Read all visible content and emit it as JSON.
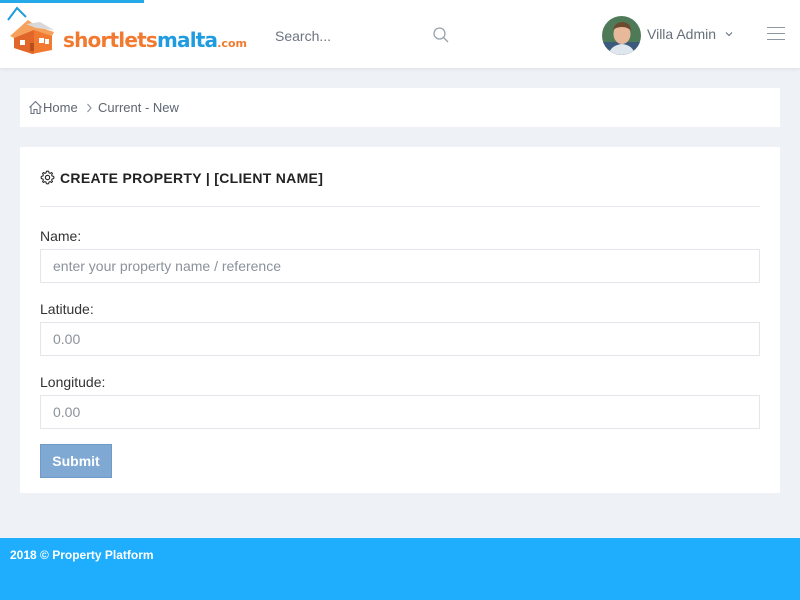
{
  "header": {
    "logo": {
      "brand": "shortlets",
      "brand_accent": "malta",
      "tld": ".com"
    },
    "search": {
      "placeholder": "Search..."
    },
    "user": {
      "name": "Villa Admin"
    }
  },
  "breadcrumb": {
    "home": "Home",
    "current": "Current - New"
  },
  "form": {
    "title": "CREATE PROPERTY | [CLIENT NAME]",
    "fields": [
      {
        "label": "Name:",
        "placeholder": "enter your property name / reference",
        "value": ""
      },
      {
        "label": "Latitude:",
        "placeholder": "0.00",
        "value": ""
      },
      {
        "label": "Longitude:",
        "placeholder": "0.00",
        "value": ""
      }
    ],
    "submit_label": "Submit"
  },
  "footer": {
    "text": "2018 © Property Platform"
  },
  "colors": {
    "primary_blue": "#1fadfd",
    "logo_orange": "#f27930",
    "logo_blue": "#1f9be0",
    "submit": "#7fa9d2"
  },
  "icons": [
    "house-logo-icon",
    "search-icon",
    "chevron-down-icon",
    "hamburger-menu-icon",
    "home-icon",
    "chevron-right-icon",
    "gear-icon"
  ]
}
